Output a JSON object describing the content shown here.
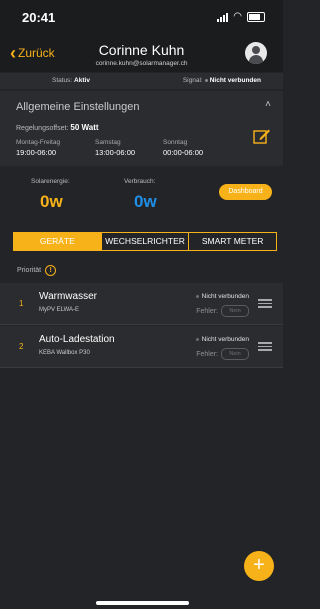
{
  "status_bar": {
    "time": "20:41"
  },
  "header": {
    "back_label": "Zurück",
    "user_name": "Corinne Kuhn",
    "user_email": "corinne.kuhn@solarmanager.ch"
  },
  "status": {
    "status_label": "Status:",
    "status_value": "Aktiv",
    "signal_label": "Signal:",
    "signal_value": "Nicht verbunden"
  },
  "settings": {
    "title": "Allgemeine Einstellungen",
    "offset_label": "Regelungsoffset:",
    "offset_value": "50 Watt",
    "schedule": [
      {
        "day": "Montag-Freitag",
        "time": "19:00-06:00"
      },
      {
        "day": "Samstag",
        "time": "13:00-06:00"
      },
      {
        "day": "Sonntag",
        "time": "00:00-06:00"
      }
    ]
  },
  "energy": {
    "solar_label": "Solarenergie:",
    "solar_value": "0w",
    "consumption_label": "Verbrauch:",
    "consumption_value": "0w",
    "dashboard_label": "Dashboard"
  },
  "tabs": [
    {
      "label": "GERÄTE",
      "active": true
    },
    {
      "label": "WECHSELRICHTER",
      "active": false
    },
    {
      "label": "SMART METER",
      "active": false
    }
  ],
  "priority_label": "Priorität",
  "devices": [
    {
      "num": "1",
      "name": "Warmwasser",
      "model": "MyPV ELWA-E",
      "status": "Nicht verbunden",
      "error_label": "Fehler:",
      "error_pill": "Nein"
    },
    {
      "num": "2",
      "name": "Auto-Ladestation",
      "model": "KEBA Wallbox P30",
      "status": "Nicht verbunden",
      "error_label": "Fehler:",
      "error_pill": "Nein"
    }
  ],
  "fab_label": "+",
  "colors": {
    "accent": "#f8b219",
    "blue": "#1f8fe6",
    "background": "#232427",
    "panel": "#2b2c2f"
  }
}
